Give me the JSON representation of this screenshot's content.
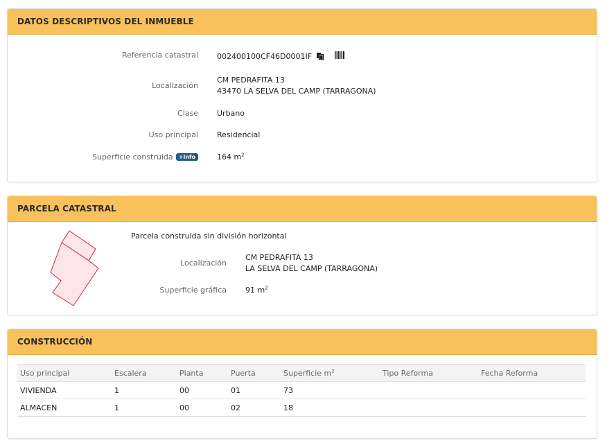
{
  "inmueble": {
    "title": "DATOS DESCRIPTIVOS DEL INMUEBLE",
    "fields": [
      {
        "label": "Referencia catastral",
        "value": "002400100CF46D0001IF"
      },
      {
        "label": "Localización",
        "value_line1": "CM PEDRAFITA 13",
        "value_line2": "43470 LA SELVA DEL CAMP (TARRAGONA)"
      },
      {
        "label": "Clase",
        "value": "Urbano"
      },
      {
        "label": "Uso principal",
        "value": "Residencial"
      },
      {
        "label": "Superficie construida",
        "badge": "+Info",
        "value": "164 m",
        "unit_sup": "2"
      }
    ],
    "icons": {
      "copy": "copy-icon",
      "barcode": "barcode-icon"
    }
  },
  "parcela": {
    "title": "PARCELA CATASTRAL",
    "subtitle": "Parcela construida sin división horizontal",
    "fields": [
      {
        "label": "Localización",
        "value_line1": "CM PEDRAFITA 13",
        "value_line2": "LA SELVA DEL CAMP (TARRAGONA)"
      },
      {
        "label": "Superficie gráfica",
        "value": "91 m",
        "unit_sup": "2"
      }
    ],
    "parcel_color": "#d1243a",
    "parcel_fill": "#fde6ea"
  },
  "construccion": {
    "title": "CONSTRUCCIÓN",
    "columns": [
      "Uso principal",
      "Escalera",
      "Planta",
      "Puerta",
      "Superficie m",
      "Tipo Reforma",
      "Fecha Reforma"
    ],
    "superficie_sup": "2",
    "rows": [
      [
        "VIVIENDA",
        "1",
        "00",
        "01",
        "73",
        "",
        ""
      ],
      [
        "ALMACEN",
        "1",
        "00",
        "02",
        "18",
        "",
        ""
      ]
    ]
  },
  "colors": {
    "header": "#f8c15c",
    "badge": "#1e5d87"
  }
}
